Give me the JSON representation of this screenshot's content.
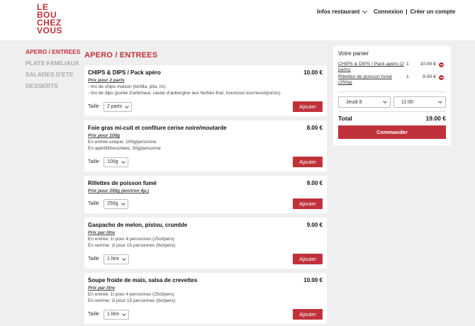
{
  "header": {
    "logo_lines": [
      "LE",
      "BOU",
      "CHEZ",
      "VOUS"
    ],
    "infos_label": "Infos restaurant",
    "login_label": "Connexion",
    "separator": "|",
    "signup_label": "Créer un compte"
  },
  "sidebar": {
    "items": [
      {
        "label": "APERO / ENTREES"
      },
      {
        "label": "PLATS FAMILIAUX"
      },
      {
        "label": "SALADES D'ETE"
      },
      {
        "label": "DESSERTS"
      }
    ]
  },
  "main": {
    "section_title": "APERO / ENTREES",
    "size_label": "Taille",
    "add_label": "Ajouter",
    "items": [
      {
        "name": "CHIPS & DIPS / Pack apéro",
        "price": "10.00 €",
        "sub": "Prix pour 2 parts",
        "desc": [
          "- trio de chips maison (tortilla, pita, riz)",
          "- trio de dips (purée d'artichaut, caviar d'aubergine aux herbes thaï, houmous tournesol/ponzu)"
        ],
        "size": "2 parts"
      },
      {
        "name": "Foie gras mi-cuit et confiture cerise noire/moutarde",
        "price": "8.00 €",
        "sub": "Prix pour 100g",
        "desc": [
          "En entrée unique, 100g/personne",
          "En apéritif/bouchées, 50g/personne"
        ],
        "size": "100g"
      },
      {
        "name": "Rillettes de poisson fumé",
        "price": "9.00 €",
        "sub": "Prix pour 250g (environ 4p.)",
        "desc": [],
        "size": "250g"
      },
      {
        "name": "Gaspacho de melon, pistou, crumble",
        "price": "9.00 €",
        "sub": "Prix par litre",
        "desc": [
          "En entrée: 1l pour 4 personnes (25cl/pers)",
          "En verrine: 1l pour 15 personnes (6cl/pers)"
        ],
        "size": "1 litre"
      },
      {
        "name": "Soupe froide de maïs, salsa de crevettes",
        "price": "10.00 €",
        "sub": "Prix par litre",
        "desc": [
          "En entrée: 1l pour 4 personnes (25cl/pers)",
          "En verrine: 1l pour 15 personnes (6cl/pers)"
        ],
        "size": "1 litre"
      }
    ]
  },
  "cart": {
    "title": "Votre panier",
    "rows": [
      {
        "name": "CHIPS & DIPS / Pack apéro (2 parts)",
        "qty": "1",
        "price": "10.00 €"
      },
      {
        "name": "Rillettes de poisson fumé (250g)",
        "qty": "1",
        "price": "9.00 €"
      }
    ],
    "day": "Jeudi 9",
    "time": "11:00",
    "total_label": "Total",
    "total_value": "19.00 €",
    "order_label": "Commander"
  },
  "colors": {
    "accent": "#c0323a",
    "background": "#efefef"
  }
}
